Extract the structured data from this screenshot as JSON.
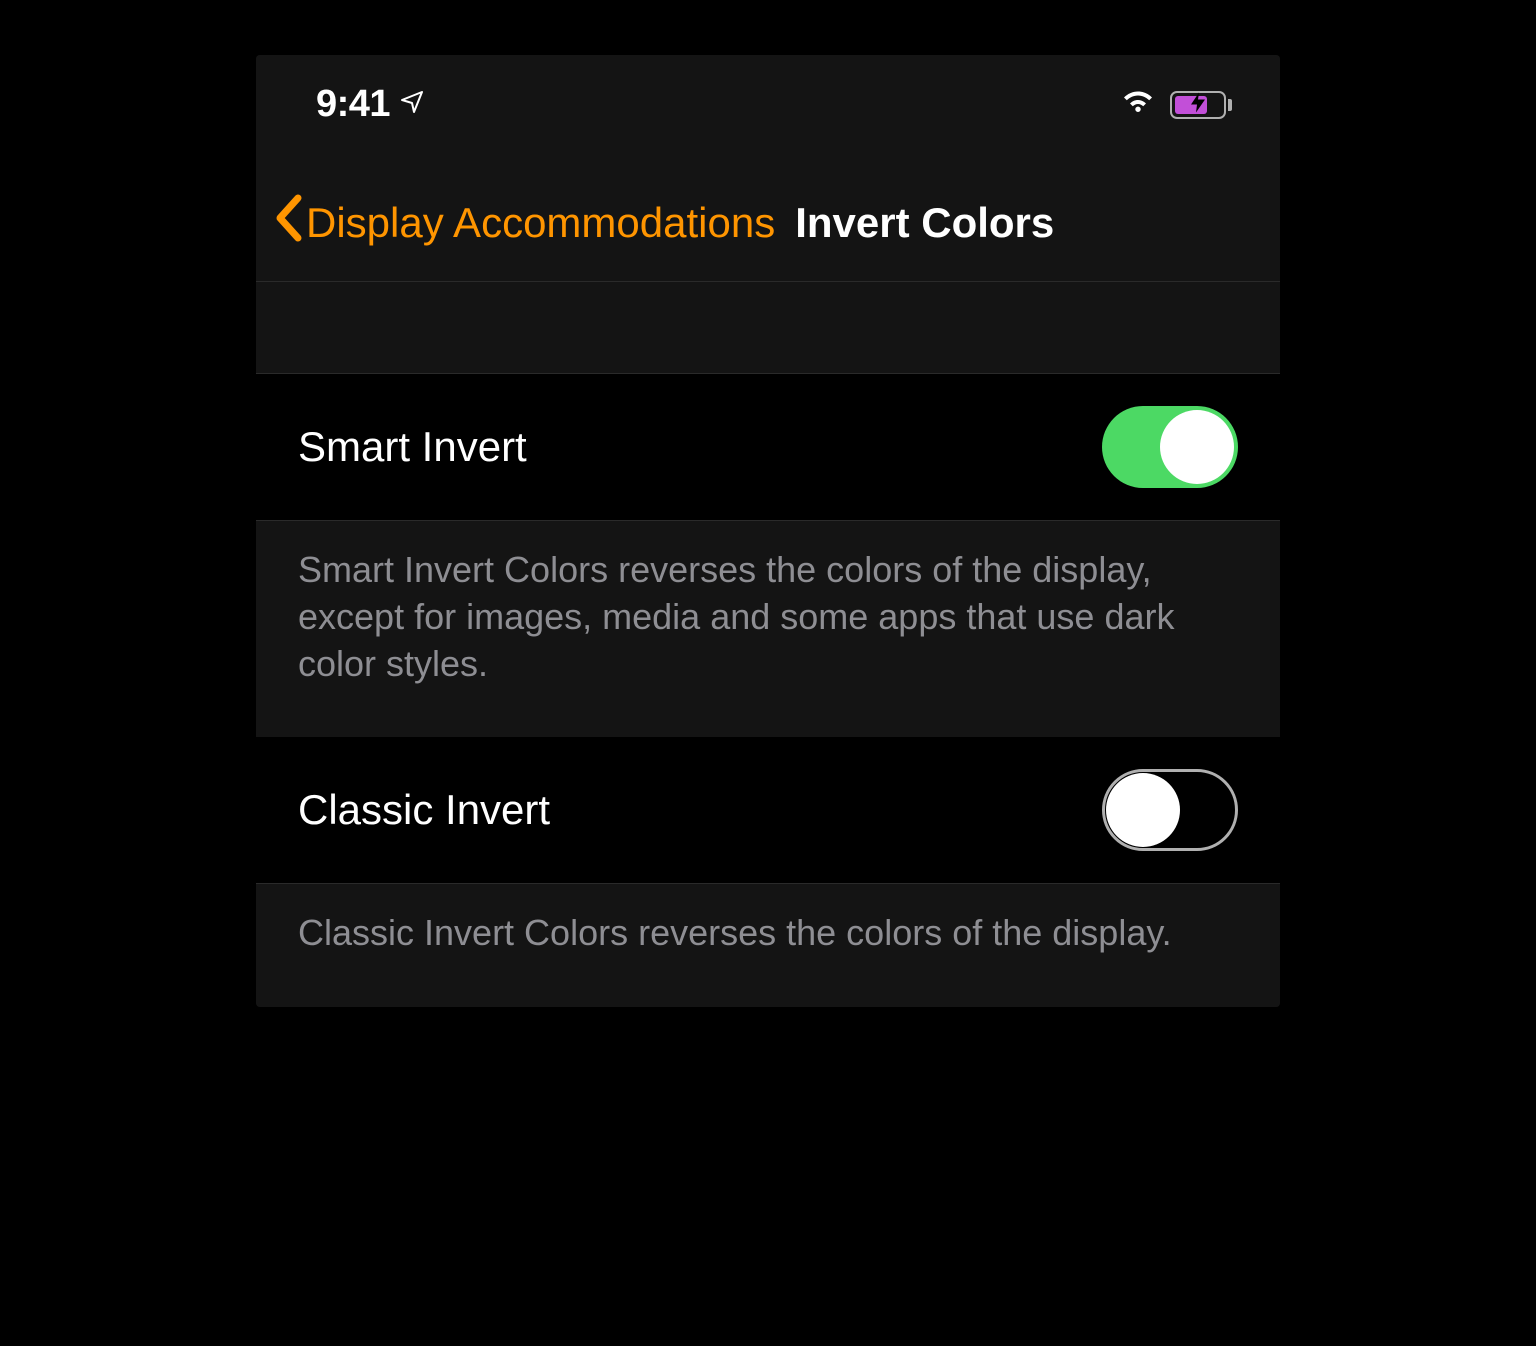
{
  "status_bar": {
    "time": "9:41"
  },
  "nav": {
    "back_label": "Display Accommodations",
    "title": "Invert Colors"
  },
  "rows": {
    "smart_invert": {
      "label": "Smart Invert",
      "enabled": true,
      "footer": "Smart Invert Colors reverses the colors of the display, except for images, media and some apps that use dark color styles."
    },
    "classic_invert": {
      "label": "Classic Invert",
      "enabled": false,
      "footer": "Classic Invert Colors reverses the colors of the display."
    }
  },
  "colors": {
    "accent": "#ff9500",
    "toggle_on": "#4cd964",
    "battery_fill": "#c24fd8"
  }
}
